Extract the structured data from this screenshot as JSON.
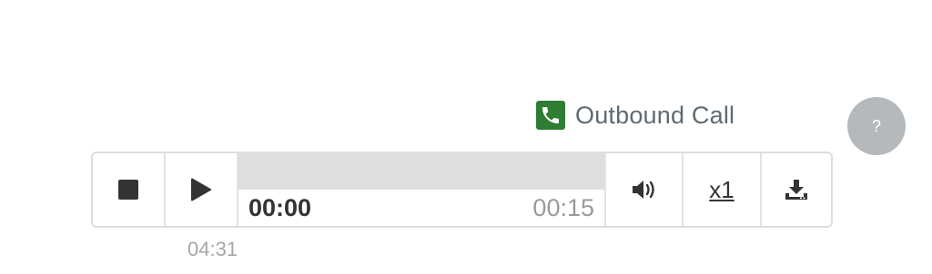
{
  "call": {
    "type_label": "Outbound Call",
    "icon": "phone-icon",
    "icon_bg": "#2e7d32"
  },
  "help": {
    "label": "?"
  },
  "player": {
    "stop_icon": "stop-icon",
    "play_icon": "play-icon",
    "current_time": "00:00",
    "total_time": "00:15",
    "progress": 0,
    "volume_icon": "volume-icon",
    "speed_label": "x1",
    "download_icon": "download-icon"
  },
  "timestamp": "04:31"
}
